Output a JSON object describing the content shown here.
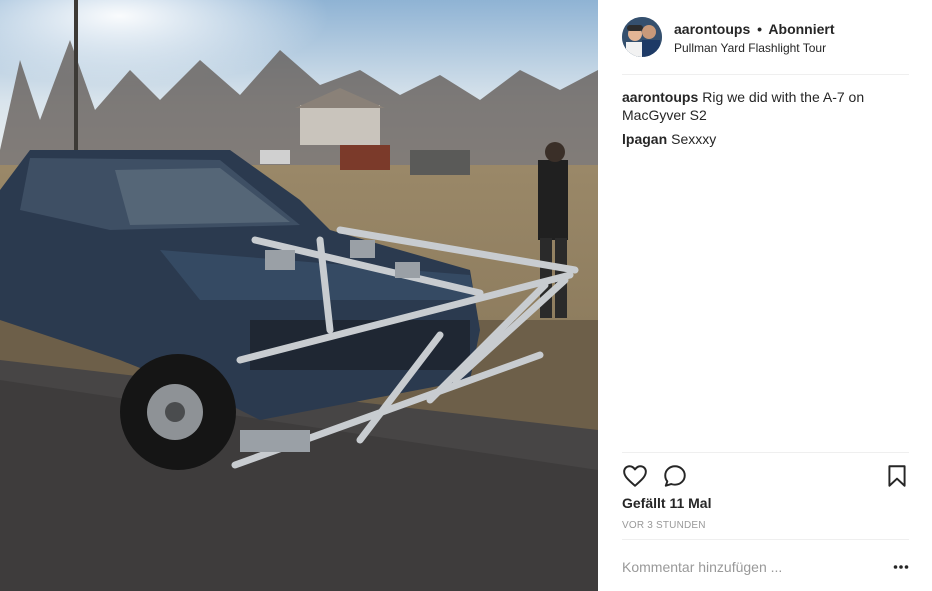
{
  "post": {
    "image_description_icon": "photo",
    "author": {
      "username": "aarontoups",
      "separator": "•",
      "follow_status": "Abonniert",
      "location": "Pullman Yard Flashlight Tour"
    },
    "comments": [
      {
        "author": "aarontoups",
        "text": "Rig we did with the A-7 on MacGyver S2"
      },
      {
        "author": "lpagan",
        "text": "Sexxxy"
      }
    ],
    "actions": {
      "like_icon": "heart-icon",
      "comment_icon": "comment-icon",
      "save_icon": "bookmark-icon"
    },
    "likes_text": "Gefällt 11 Mal",
    "timestamp": "VOR 3 STUNDEN",
    "add_comment": {
      "placeholder": "Kommentar hinzufügen ...",
      "more_icon": "more-options-icon"
    }
  }
}
